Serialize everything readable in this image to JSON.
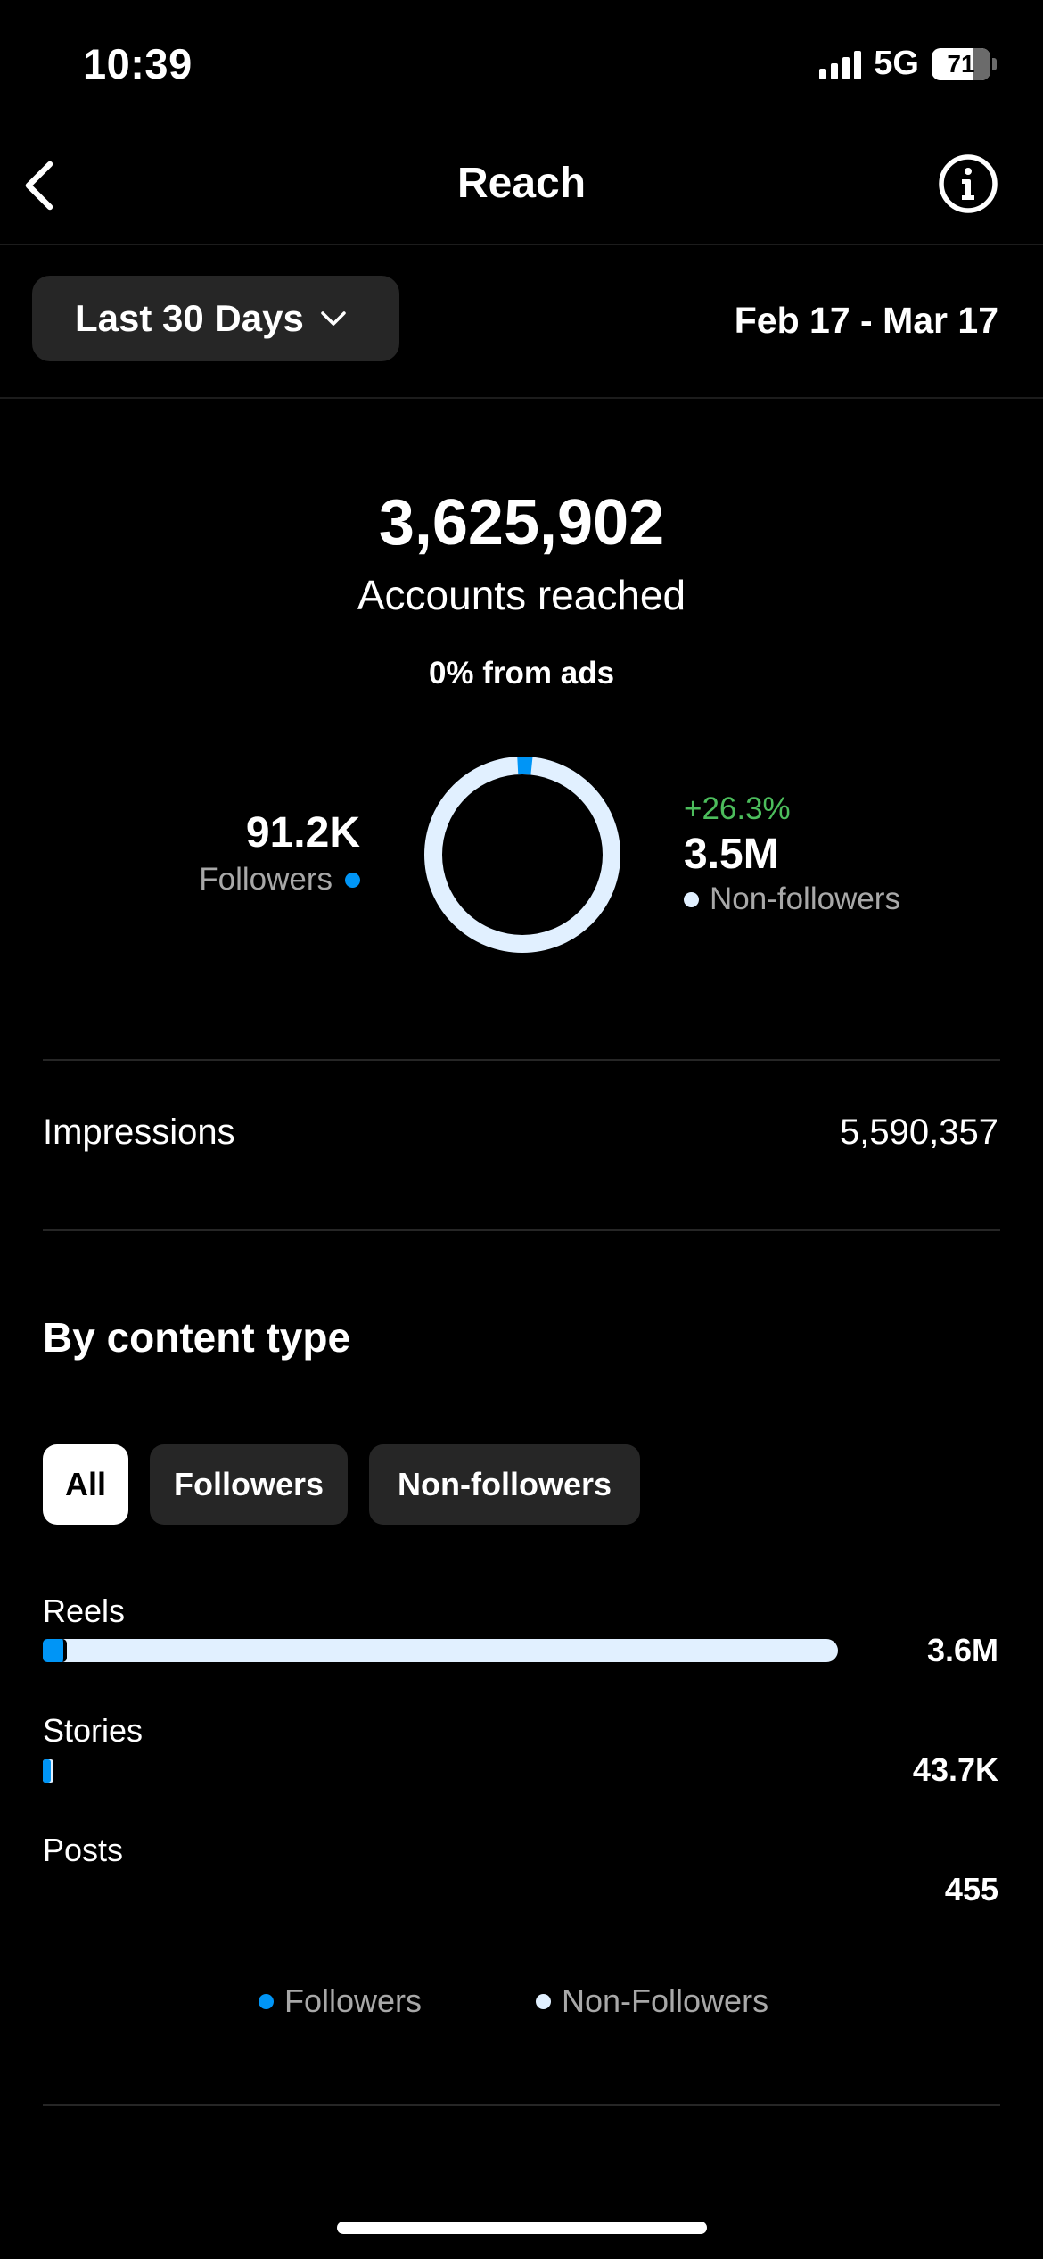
{
  "status": {
    "time": "10:39",
    "network": "5G",
    "battery": "71"
  },
  "nav": {
    "title": "Reach",
    "back_icon": "chevron-left-icon",
    "info_icon": "info-icon"
  },
  "range": {
    "label": "Last 30 Days",
    "dates": "Feb 17 - Mar 17"
  },
  "summary": {
    "total": "3,625,902",
    "total_label": "Accounts reached",
    "ads_note": "0% from ads",
    "followers_value": "91.2K",
    "followers_label": "Followers",
    "nonfollowers_change": "+26.3%",
    "nonfollowers_value": "3.5M",
    "nonfollowers_label": "Non-followers",
    "followers_share": 0.025
  },
  "impressions": {
    "label": "Impressions",
    "value": "5,590,357"
  },
  "content": {
    "title": "By content type",
    "tabs": [
      "All",
      "Followers",
      "Non-followers"
    ],
    "active_tab": 0,
    "rows": [
      {
        "label": "Reels",
        "value": "3.6M",
        "total_fraction": 1.0,
        "followers_fraction": 0.03
      },
      {
        "label": "Stories",
        "value": "43.7K",
        "total_fraction": 0.013,
        "followers_fraction": 0.8
      },
      {
        "label": "Posts",
        "value": "455",
        "total_fraction": 0.0,
        "followers_fraction": 0.0
      }
    ],
    "legend": [
      "Followers",
      "Non-Followers"
    ]
  },
  "colors": {
    "followers": "#0095f6",
    "non_followers": "#e1f0ff",
    "positive": "#4cbd5c",
    "background": "#000000"
  }
}
